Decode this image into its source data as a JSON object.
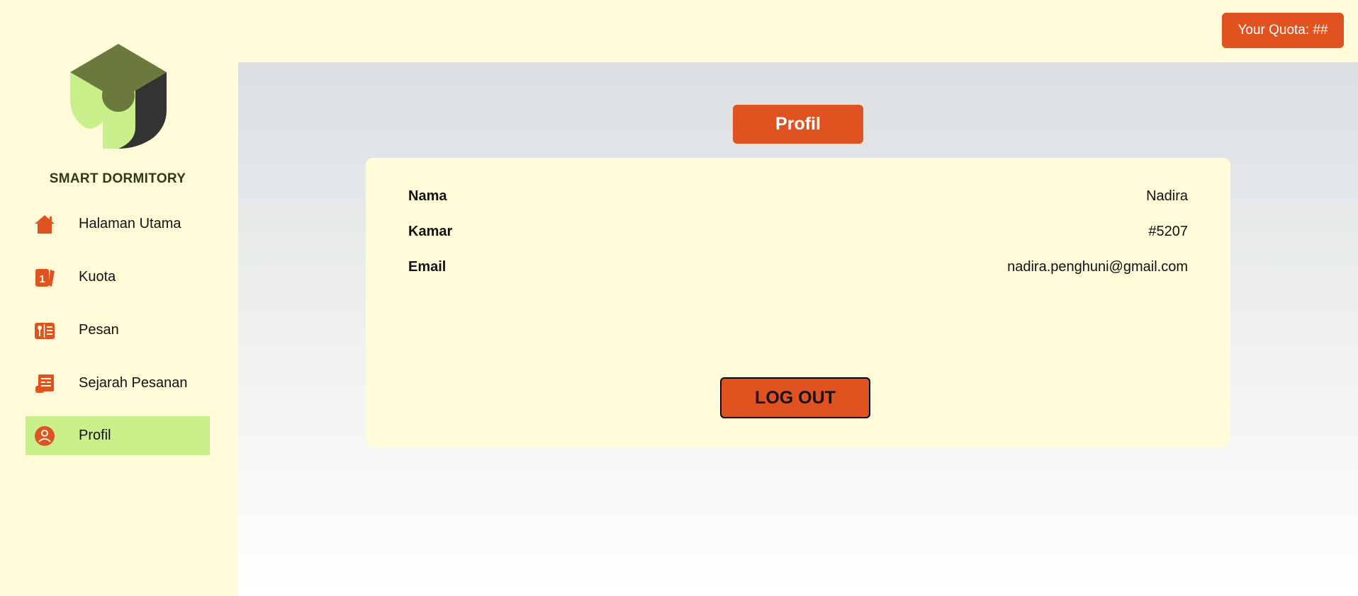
{
  "app": {
    "brand": "SMART DORMITORY",
    "logo_icon": "shield-logo-icon"
  },
  "colors": {
    "accent": "#e0521f",
    "background": "#fffbd9",
    "active_nav": "#c8ef8a",
    "logo_dark": "#6b7a3c",
    "logo_light": "#c9ef8b"
  },
  "sidebar": {
    "items": [
      {
        "label": "Halaman Utama",
        "icon": "home-icon",
        "active": false
      },
      {
        "label": "Kuota",
        "icon": "quota-card-icon",
        "active": false
      },
      {
        "label": "Pesan",
        "icon": "menu-order-icon",
        "active": false
      },
      {
        "label": "Sejarah Pesanan",
        "icon": "order-history-icon",
        "active": false
      },
      {
        "label": "Profil",
        "icon": "profile-icon",
        "active": true
      }
    ]
  },
  "header": {
    "quota_label": "Your Quota: ##"
  },
  "main": {
    "title": "Profil",
    "profile": {
      "fields": [
        {
          "label": "Nama",
          "value": "Nadira"
        },
        {
          "label": "Kamar",
          "value": "#5207"
        },
        {
          "label": "Email",
          "value": "nadira.penghuni@gmail.com"
        }
      ]
    },
    "logout_label": "LOG OUT"
  }
}
